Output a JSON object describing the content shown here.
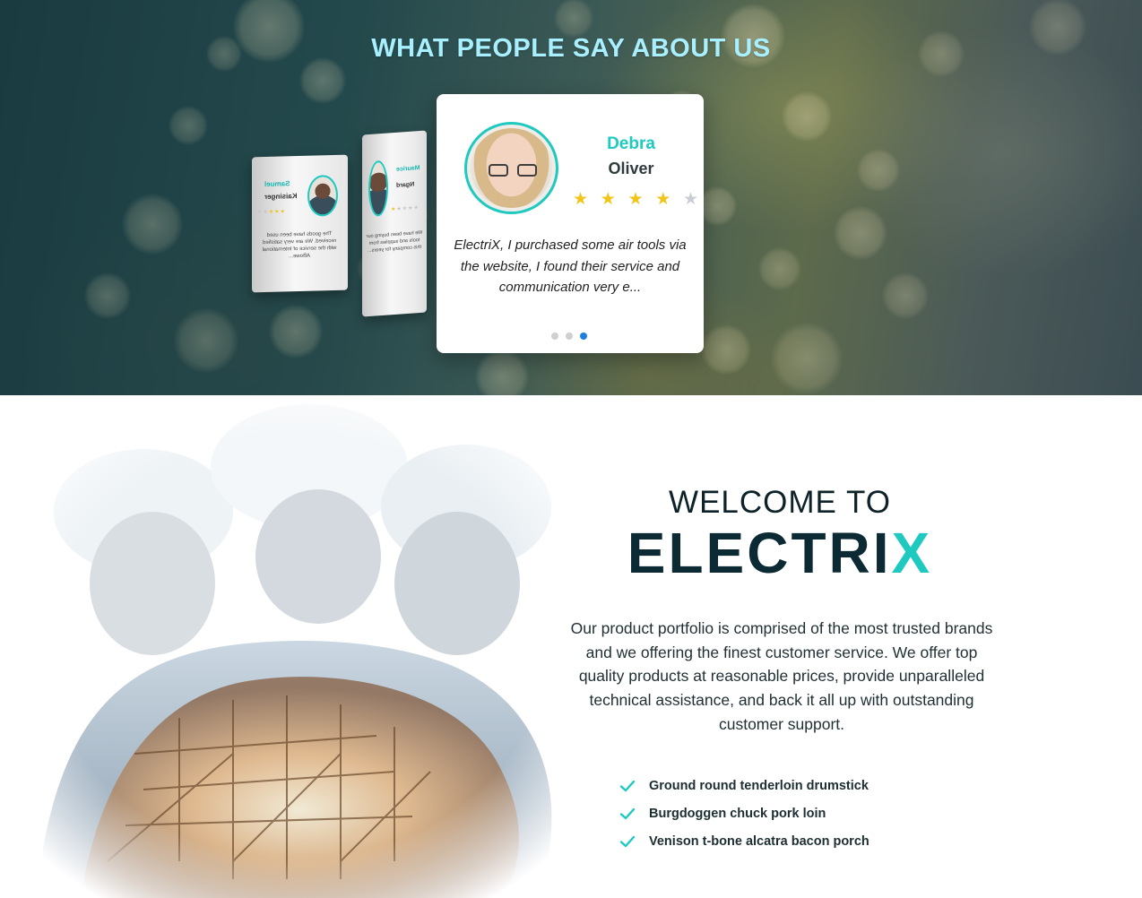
{
  "testimonials": {
    "title": "WHAT PEOPLE SAY ABOUT US",
    "active": {
      "first_name": "Debra",
      "last_name": "Oliver",
      "rating": 4,
      "max_rating": 5,
      "quote": "ElectriX, I purchased some air tools via the website, I found their service and communication very e..."
    },
    "side_cards": [
      {
        "first_name": "Samuel",
        "last_name": "Kaisinger",
        "rating": 3,
        "quote": "The goods have been used received. We are very satisfied with the service of International ABowe..."
      },
      {
        "first_name": "Maurice",
        "last_name": "Ngard",
        "rating": 1,
        "quote": "We have been buying our tools and supplies from this company for years..."
      }
    ],
    "slider": {
      "count": 3,
      "active_index": 2
    }
  },
  "welcome": {
    "heading": "WELCOME TO",
    "brand_main": "ELECTRI",
    "brand_accent": "X",
    "description": "Our product portfolio is comprised of the most trusted brands and we offering the finest customer service. We offer top quality products at reasonable prices, provide unparalleled technical assistance, and back it all up with outstanding customer support.",
    "features": [
      "Ground round tenderloin drumstick",
      "Burgdoggen chuck pork loin",
      "Venison t-bone alcatra bacon porch"
    ]
  },
  "colors": {
    "accent": "#1ec9c0",
    "title": "#a8f0ff",
    "dark": "#0b2a33",
    "star": "#f2c418",
    "dot_active": "#1e7fe0"
  },
  "icons": {
    "check": "check-icon",
    "star": "star-icon"
  }
}
